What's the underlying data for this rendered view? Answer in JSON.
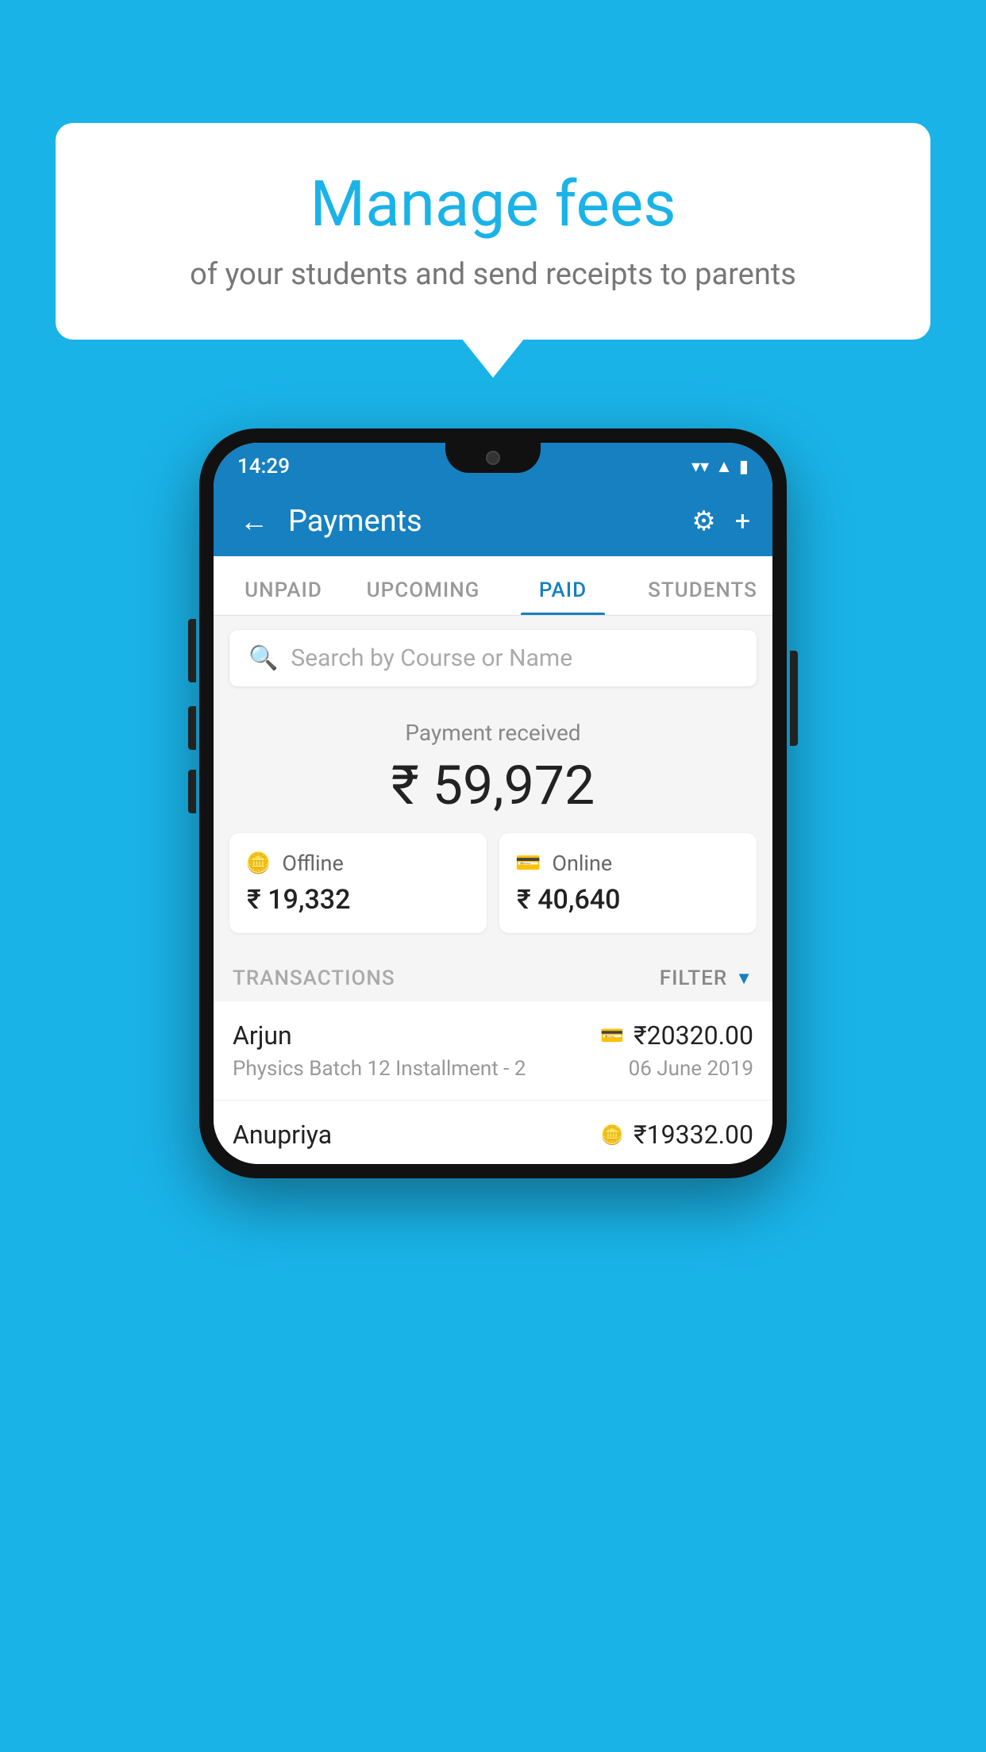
{
  "background_color": "#1ab3e8",
  "speech_bubble": {
    "title": "Manage fees",
    "subtitle": "of your students and send receipts to parents"
  },
  "phone": {
    "status_bar": {
      "time": "14:29",
      "icons": [
        "wifi",
        "signal",
        "battery"
      ]
    },
    "header": {
      "title": "Payments",
      "back_label": "←",
      "settings_label": "⚙",
      "plus_label": "+"
    },
    "tabs": [
      {
        "label": "UNPAID",
        "active": false
      },
      {
        "label": "UPCOMING",
        "active": false
      },
      {
        "label": "PAID",
        "active": true
      },
      {
        "label": "STUDENTS",
        "active": false
      }
    ],
    "search": {
      "placeholder": "Search by Course or Name"
    },
    "payment_summary": {
      "label": "Payment received",
      "total": "₹ 59,972",
      "offline": {
        "label": "Offline",
        "amount": "₹ 19,332"
      },
      "online": {
        "label": "Online",
        "amount": "₹ 40,640"
      }
    },
    "transactions": {
      "section_label": "TRANSACTIONS",
      "filter_label": "FILTER",
      "items": [
        {
          "name": "Arjun",
          "amount": "₹20320.00",
          "course": "Physics Batch 12 Installment - 2",
          "date": "06 June 2019",
          "payment_type": "card"
        },
        {
          "name": "Anupriya",
          "amount": "₹19332.00",
          "course": "",
          "date": "",
          "payment_type": "cash"
        }
      ]
    }
  }
}
